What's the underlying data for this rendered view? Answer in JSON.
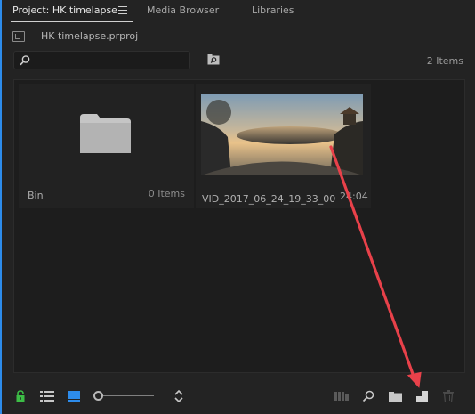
{
  "tabs": [
    {
      "label": "Project: HK timelapse",
      "active": true
    },
    {
      "label": "Media Browser",
      "active": false
    },
    {
      "label": "Libraries",
      "active": false
    }
  ],
  "project": {
    "file_name": "HK timelapse.prproj"
  },
  "search": {
    "value": "",
    "placeholder": ""
  },
  "items_count": "2 Items",
  "bin_item": {
    "name": "Bin",
    "count": "0 Items"
  },
  "clip_item": {
    "name": "VID_2017_06_24_19_33_00_...",
    "duration": "24:04"
  },
  "toolbar": {
    "icons": [
      "lock-icon",
      "list-view-icon",
      "icon-view-icon",
      "zoom-slider",
      "sort-icon",
      "automate-to-sequence-icon",
      "find-icon",
      "new-bin-icon",
      "new-item-icon",
      "clear-icon"
    ],
    "zoom_level": 0.0
  },
  "colors": {
    "accent": "#2d8ceb",
    "lock_green": "#3cbd46",
    "annotation_red": "#e8414a"
  }
}
